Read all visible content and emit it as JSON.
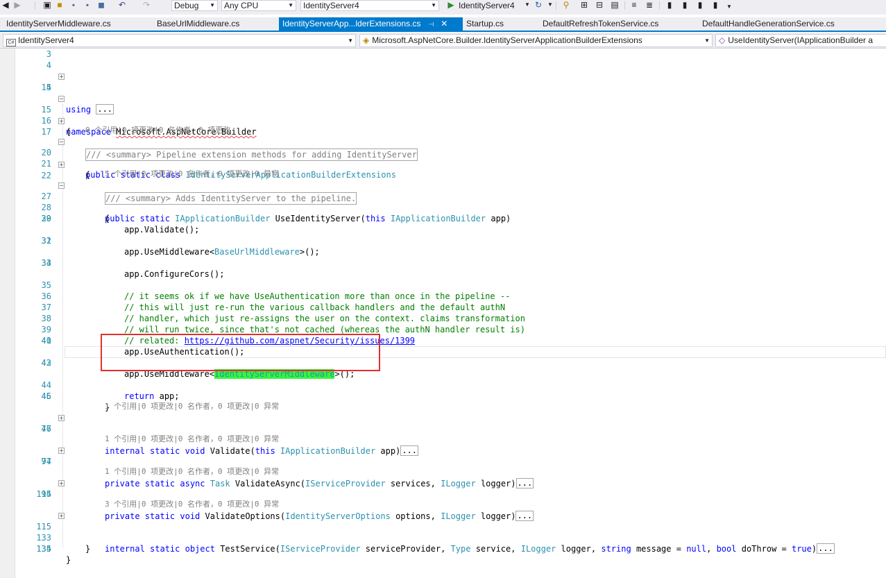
{
  "toolbar": {
    "config": "Debug",
    "platform": "Any CPU",
    "startup_project": "IdentityServer4",
    "run_label": "IdentityServer4"
  },
  "tabs": [
    {
      "label": "IdentityServerMiddleware.cs"
    },
    {
      "label": "BaseUrlMiddleware.cs"
    },
    {
      "label": "IdentityServerApp...lderExtensions.cs",
      "active": true
    },
    {
      "label": "Startup.cs"
    },
    {
      "label": "DefaultRefreshTokenService.cs"
    },
    {
      "label": "DefaultHandleGenerationService.cs"
    }
  ],
  "navbar": {
    "project": "IdentityServer4",
    "project_icon": "C#",
    "type": "Microsoft.AspNetCore.Builder.IdentityServerApplicationBuilderExtensions",
    "member": "UseIdentityServer(IApplicationBuilder a"
  },
  "code": {
    "ln": {
      "l3": "3",
      "l4": "4",
      "l5": "5",
      "l14": "14",
      "l15": "15",
      "l16": "16",
      "l17": "17",
      "l20": "20",
      "l21": "21",
      "l22": "22",
      "l27": "27",
      "l28": "28",
      "l29": "29",
      "l30": "30",
      "l31": "31",
      "l32": "32",
      "l33": "33",
      "l34": "34",
      "l35": "35",
      "l36": "36",
      "l37": "37",
      "l38": "38",
      "l39": "39",
      "l40": "40",
      "l41": "41",
      "l42": "42",
      "l43": "43",
      "l44": "44",
      "l45": "45",
      "l46": "46",
      "l47": "47",
      "l76": "76",
      "l77": "77",
      "l94": "94",
      "l95": "95",
      "l114": "114",
      "l115": "115",
      "l133": "133",
      "l134": "134",
      "l135": "135"
    },
    "using_kw": "using",
    "collapsed": "...",
    "namespace_kw": "namespace",
    "namespace_name": "Microsoft.AspNetCore.Builder",
    "open_brace": "{",
    "close_brace": "}",
    "summary1": "/// <summary> Pipeline extension methods for adding IdentityServer",
    "lens_class": "0 个引用|0 项更改|0 名作者，0 项更改",
    "public_static_class_kw": "public static class",
    "class_name": "IdentityServerApplicationBuilderExtensions",
    "summary2": "/// <summary> Adds IdentityServer to the pipeline.",
    "lens_method1": "5 个引用|0 项更改|0 名作者，0 项更改|0 异常",
    "public_static_kw": "public static",
    "iapp": "IApplicationBuilder",
    "method_name": "UseIdentityServer(",
    "this_kw": "this",
    "app_param": "app)",
    "validate_call": "app.Validate();",
    "use_mw_prefix": "app.UseMiddleware<",
    "baseurl_mw": "BaseUrlMiddleware",
    "call_suffix": ">();",
    "configure_cors": "app.ConfigureCors();",
    "comment35": "// it seems ok if we have UseAuthentication more than once in the pipeline --",
    "comment36": "// this will just re-run the various callback handlers and the default authN",
    "comment37": "// handler, which just re-assigns the user on the context. claims transformation",
    "comment38": "// will run twice, since that's not cached (whereas the authN handler result is)",
    "comment39_prefix": "// related: ",
    "comment39_link": "https://github.com/aspnet/Security/issues/1399",
    "use_auth": "app.UseAuthentication();",
    "idsrv_mw": "IdentityServerMiddleware",
    "return_kw": "return",
    "return_rest": "app;",
    "lens_1ref": "1 个引用|0 项更改|0 名作者，0 项更改|0 异常",
    "lens_3ref": "3 个引用|0 项更改|0 名作者，0 项更改|0 异常",
    "internal_static_void_kw": "internal static void",
    "validate_sig": "Validate(",
    "private_static_async_kw": "private static async",
    "task_type": "Task",
    "validate_async": "ValidateAsync(",
    "isp": "IServiceProvider",
    "services_param": "services,",
    "ilogger": "ILogger",
    "logger_close": "logger)",
    "private_static_void_kw": "private static void",
    "validate_options": "ValidateOptions(",
    "idsrv_options": "IdentityServerOptions",
    "options_param": "options,",
    "internal_static_object_kw": "internal static object",
    "test_service": "TestService(",
    "sp_param": "serviceProvider,",
    "type_type": "Type",
    "service_param": "service,",
    "logger_param": "logger,",
    "string_kw": "string",
    "message_eq": "message =",
    "null_kw": "null",
    "bool_kw": "bool",
    "dothrow_eq": "doThrow =",
    "true_kw": "true"
  }
}
